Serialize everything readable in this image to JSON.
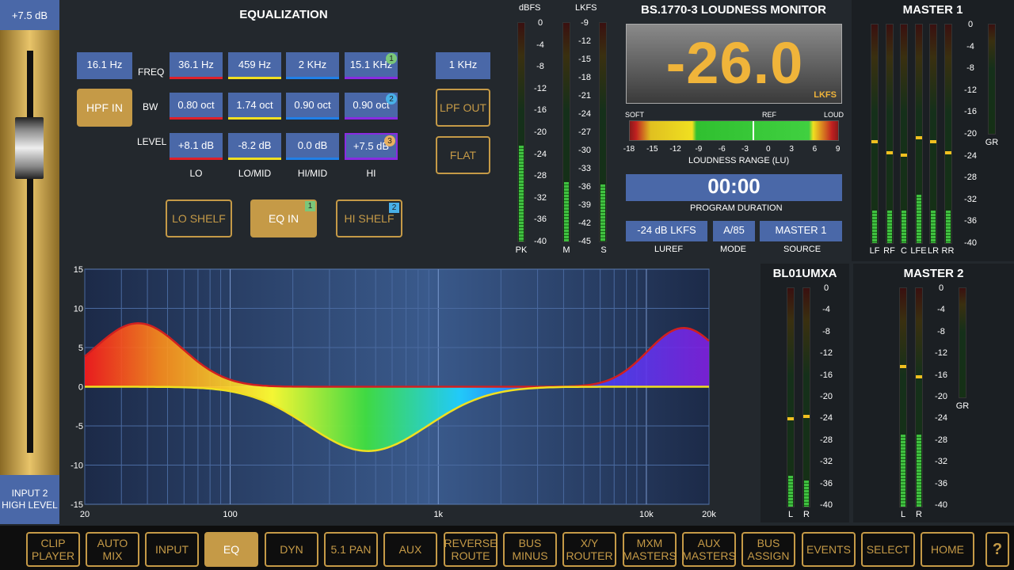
{
  "fader": {
    "gain": "+7.5 dB",
    "input_name": "INPUT 2 HIGH LEVEL"
  },
  "eq": {
    "title": "EQUALIZATION",
    "row_labels": {
      "freq": "FREQ",
      "bw": "BW",
      "level": "LEVEL"
    },
    "hpf_freq": "16.1 Hz",
    "hpf_button": "HPF IN",
    "lpf_freq": "1 KHz",
    "lpf_button": "LPF OUT",
    "flat_button": "FLAT",
    "bands": [
      {
        "name": "LO",
        "freq": "36.1 Hz",
        "bw": "0.80 oct",
        "level": "+8.1 dB",
        "color": "#e0202a"
      },
      {
        "name": "LO/MID",
        "freq": "459 Hz",
        "bw": "1.74 oct",
        "level": "-8.2 dB",
        "color": "#f0e020"
      },
      {
        "name": "HI/MID",
        "freq": "2 KHz",
        "bw": "0.90 oct",
        "level": "0.0 dB",
        "color": "#2080e8"
      },
      {
        "name": "HI",
        "freq": "15.1 KHz",
        "bw": "0.90 oct",
        "level": "+7.5 dB",
        "color": "#8a2be2"
      }
    ],
    "badges": {
      "freq": "1",
      "bw": "2",
      "level": "3"
    },
    "lo_shelf": "LO SHELF",
    "eq_in": "EQ IN",
    "eq_in_badge": "1",
    "hi_shelf": "HI SHELF",
    "hi_shelf_badge": "2"
  },
  "eq_graph": {
    "y_ticks": [
      "15",
      "10",
      "5",
      "0",
      "-5",
      "-10",
      "-15"
    ],
    "x_ticks": [
      "20",
      "100",
      "1k",
      "10k",
      "20k"
    ]
  },
  "meters": {
    "dbfs_label": "dBFS",
    "lkfs_label": "LKFS",
    "dbfs_ticks": [
      "0",
      "-4",
      "-8",
      "-12",
      "-16",
      "-20",
      "-24",
      "-28",
      "-32",
      "-36",
      "-40"
    ],
    "lkfs_ticks": [
      "-9",
      "-12",
      "-15",
      "-18",
      "-21",
      "-24",
      "-27",
      "-30",
      "-33",
      "-36",
      "-39",
      "-42",
      "-45"
    ],
    "pk": "PK",
    "m": "M",
    "s": "S",
    "levels": {
      "pk": 0.44,
      "m": 0.27,
      "s": 0.26
    }
  },
  "loudness": {
    "title": "BS.1770-3 LOUDNESS MONITOR",
    "value": "-26.0",
    "unit": "LKFS",
    "soft": "SOFT",
    "ref": "REF",
    "loud": "LOUD",
    "range_ticks": [
      "-18",
      "-15",
      "-12",
      "-9",
      "-6",
      "-3",
      "0",
      "3",
      "6",
      "9"
    ],
    "range_label": "LOUDNESS RANGE (LU)",
    "duration": "00:00",
    "duration_label": "PROGRAM DURATION",
    "luref": "-24 dB LKFS",
    "luref_label": "LUREF",
    "mode": "A/85",
    "mode_label": "MODE",
    "source": "MASTER 1",
    "source_label": "SOURCE"
  },
  "master1": {
    "title": "MASTER 1",
    "channels": [
      "LF",
      "RF",
      "C",
      "LFE",
      "LR",
      "RR"
    ],
    "ticks": [
      "0",
      "-4",
      "-8",
      "-12",
      "-16",
      "-20",
      "-24",
      "-28",
      "-32",
      "-36",
      "-40"
    ],
    "gr": "GR",
    "levels": [
      0.15,
      0.15,
      0.15,
      0.22,
      0.15,
      0.15
    ]
  },
  "bl01": {
    "title": "BL01UMXA",
    "channels": [
      "L",
      "R"
    ],
    "ticks": [
      "0",
      "-4",
      "-8",
      "-12",
      "-16",
      "-20",
      "-24",
      "-28",
      "-32",
      "-36",
      "-40"
    ],
    "levels": [
      0.14,
      0.12
    ]
  },
  "master2": {
    "title": "MASTER 2",
    "channels": [
      "L",
      "R"
    ],
    "ticks": [
      "0",
      "-4",
      "-8",
      "-12",
      "-16",
      "-20",
      "-24",
      "-28",
      "-32",
      "-36",
      "-40"
    ],
    "gr": "GR",
    "levels": [
      0.33,
      0.33
    ]
  },
  "toolbar": [
    "CLIP PLAYER",
    "AUTO MIX",
    "INPUT",
    "EQ",
    "DYN",
    "5.1 PAN",
    "AUX",
    "REVERSE ROUTE",
    "BUS MINUS",
    "X/Y ROUTER",
    "MXM MASTERS",
    "AUX MASTERS",
    "BUS ASSIGN",
    "EVENTS",
    "SELECT",
    "HOME",
    "?"
  ],
  "toolbar_active": "EQ"
}
